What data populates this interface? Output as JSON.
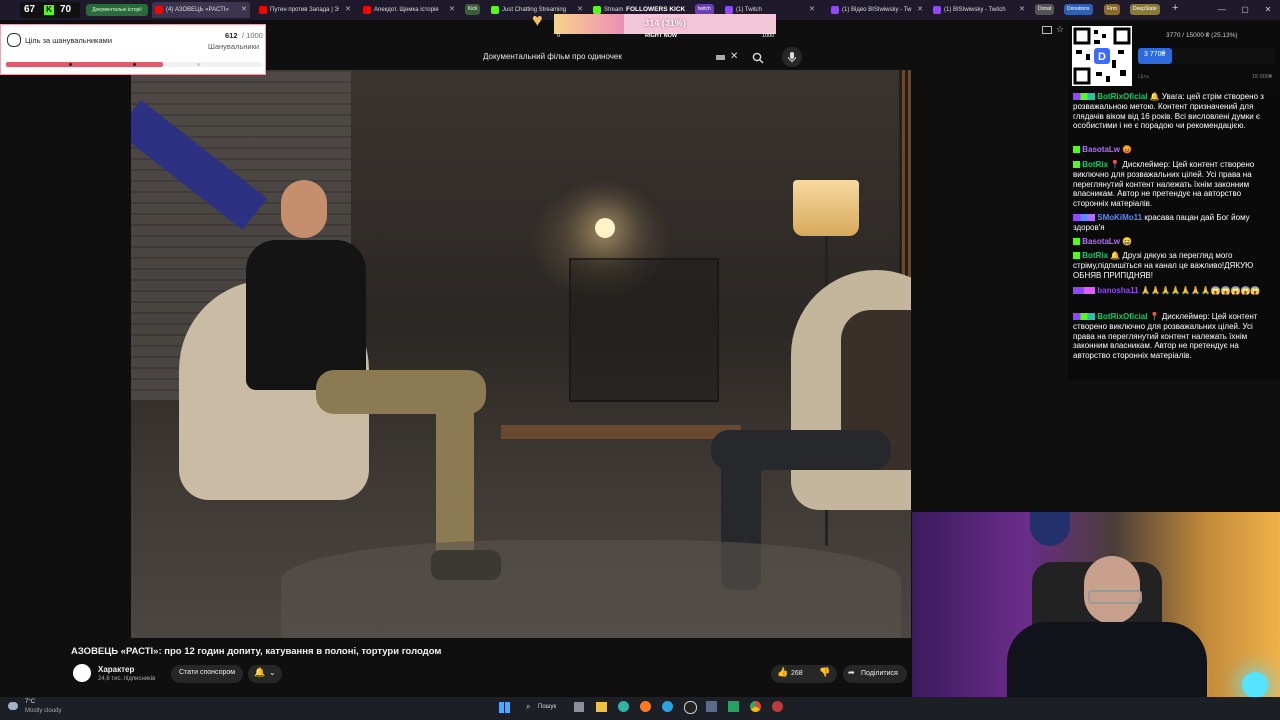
{
  "browser": {
    "counters": {
      "left": "67",
      "right": "70"
    },
    "bookmark_chip": "Документальні історії",
    "tabs": [
      {
        "title": "(4) АЗОВЕЦЬ «РАСТІ»",
        "color": "#ff0000",
        "active": true
      },
      {
        "title": "Путин против Запада | Э",
        "color": "#ff0000"
      },
      {
        "title": "Anекдот. Щемка історія",
        "color": "#ff0000"
      },
      {
        "title": "Just Chatting Streaming",
        "color": "#53fc18"
      },
      {
        "title": "Stream",
        "color": "#53fc18"
      },
      {
        "title": "(1) Twitch",
        "color": "#9146ff"
      },
      {
        "title": "(1) Відео BISIwiwsky - Tw",
        "color": "#9146ff"
      },
      {
        "title": "(1) BISIwiwsky - Twitch",
        "color": "#9146ff"
      }
    ],
    "extra_chips": [
      "Kick",
      "twitch",
      "Donat",
      "Donations",
      "Firm",
      "DeepState"
    ],
    "new_tab": "+",
    "window_buttons": [
      "—",
      "▢",
      "✕"
    ]
  },
  "goal_widget": {
    "title": "Ціль за шанувальниками",
    "current": "612",
    "target": "/ 1000",
    "subtitle": "Шанувальники",
    "progress": 0.612
  },
  "followers_widget": {
    "title": "FOLLOWERS KICK",
    "count": "314 (31%)",
    "min": "0",
    "max": "1000",
    "center_label": "RIGHT NOW",
    "progress": 0.314
  },
  "youtube": {
    "search_value": "Документальний фільм  про одиночек",
    "video_title": "АЗОВЕЦЬ «РАСТІ»: про 12 годин допиту, катування в полоні, тортури голодом",
    "channel_name": "Характер",
    "subscribers": "24,6 тис. підписників",
    "sponsor_label": "Стати спонсором",
    "likes": "268",
    "share_label": "Поділитися"
  },
  "donation_widget": {
    "progress_text": "3770 / 15000 ₴ (25.13%)",
    "current_chip": "3 770₴",
    "min_label": "Ціль",
    "max_label": "15 000₴",
    "progress": 0.2513
  },
  "chat": [
    {
      "user": "BotRixOficial",
      "color": "#00d26a",
      "text": "🔔 Увага: цей стрім створено з розважальною метою. Контент призначений для глядачів віком від 16 років. Всі висловлені думки є особистими і не є порадою чи рекомендацією."
    },
    {
      "user": "BasotaLw",
      "color": "#b56cff",
      "text": "😡"
    },
    {
      "user": "BotRix",
      "color": "#00d26a",
      "text": "📍 Дисклеймер: Цей контент створено виключно для розважальних цілей. Усі права на переглянутий контент належать їхнім законним власникам. Автор не претендує на авторство сторонніх матеріалів."
    },
    {
      "user": "SMoKiMo11",
      "color": "#5b8cff",
      "text": "красава пацан дай Бог йому здоров'я"
    },
    {
      "user": "BasotaLw",
      "color": "#b56cff",
      "text": "😄"
    },
    {
      "user": "BotRix",
      "color": "#00d26a",
      "text": "🔔 Друзі дякую за перегляд мого стріму,підпишіться на канал це важливо!ДЯКУЮ ОБНЯВ ПРИПІДНЯВ!"
    },
    {
      "user": "banosha11",
      "color": "#9146ff",
      "text": "🙏🙏🙏🙏🙏🙏🙏😱😱😱😱😱"
    },
    {
      "user": "BotRixOficial",
      "color": "#00d26a",
      "text": "📍 Дисклеймер: Цей контент створено виключно для розважальних цілей. Усі права на переглянутий контент належать їхнім законним власникам. Автор не претендує на авторство сторонніх матеріалів."
    }
  ],
  "taskbar": {
    "weather_temp": "7°C",
    "weather_text": "Mostly cloudy",
    "search_label": "Пошук"
  },
  "colors": {
    "accent_red": "#e05a6b",
    "kick_green": "#53fc18",
    "twitch_purple": "#9146ff",
    "yt_bg": "#0f0f0f"
  }
}
